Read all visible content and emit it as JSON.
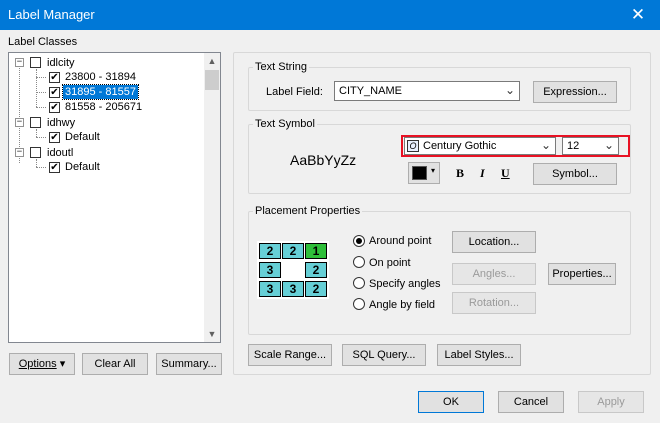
{
  "window": {
    "title": "Label Manager",
    "close_glyph": "✕"
  },
  "label_classes": {
    "heading": "Label Classes",
    "tree": [
      {
        "label": "idlcity",
        "expander": "−",
        "checked": false
      },
      {
        "label": "23800 - 31894",
        "checked": true
      },
      {
        "label": "31895 - 81557",
        "checked": true,
        "selected": true
      },
      {
        "label": "81558 - 205671",
        "checked": true
      },
      {
        "label": "idhwy",
        "expander": "−",
        "checked": false
      },
      {
        "label": "Default",
        "checked": true
      },
      {
        "label": "idoutl",
        "expander": "−",
        "checked": false
      },
      {
        "label": "Default",
        "checked": true
      }
    ],
    "buttons": {
      "options": "Options",
      "options_arrow": "▾",
      "clear_all": "Clear All",
      "summary": "Summary..."
    }
  },
  "text_string": {
    "heading": "Text String",
    "label_field_label": "Label Field:",
    "label_field_value": "CITY_NAME",
    "expression_button": "Expression..."
  },
  "text_symbol": {
    "heading": "Text Symbol",
    "preview": "AaBbYyZz",
    "font_icon": "O",
    "font_name": "Century Gothic",
    "font_size": "12",
    "color": "#000000",
    "bold": "B",
    "italic": "I",
    "underline": "U",
    "symbol_button": "Symbol...",
    "highlight_color": "#e81123"
  },
  "placement": {
    "heading": "Placement Properties",
    "grid": [
      [
        "2",
        "2",
        "1"
      ],
      [
        "3",
        "",
        "2"
      ],
      [
        "3",
        "3",
        "2"
      ]
    ],
    "options": [
      {
        "label": "Around point",
        "selected": true
      },
      {
        "label": "On point",
        "selected": false
      },
      {
        "label": "Specify angles",
        "selected": false
      },
      {
        "label": "Angle by field",
        "selected": false
      }
    ],
    "location_button": "Location...",
    "angles_button": "Angles...",
    "rotation_button": "Rotation...",
    "properties_button": "Properties..."
  },
  "bottom_buttons": {
    "scale_range": "Scale Range...",
    "sql_query": "SQL Query...",
    "label_styles": "Label Styles..."
  },
  "dialog_buttons": {
    "ok": "OK",
    "cancel": "Cancel",
    "apply": "Apply"
  },
  "scrollbar": {
    "up": "▲",
    "down": "▼"
  },
  "dropdown_glyph": "⌄"
}
